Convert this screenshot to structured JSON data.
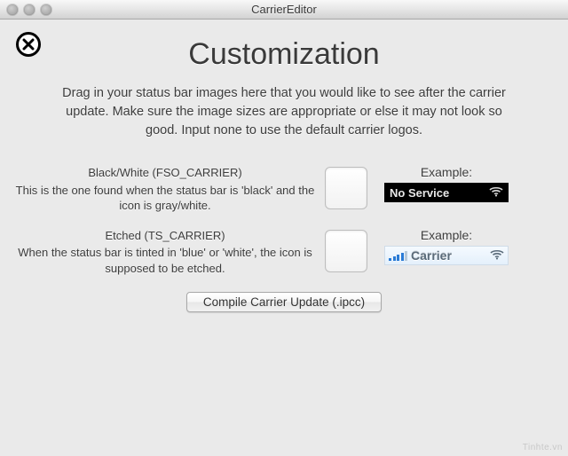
{
  "window": {
    "title": "CarrierEditor"
  },
  "page": {
    "heading": "Customization",
    "description": "Drag in your status bar images here that you would like to see after the carrier update. Make sure the image sizes are appropriate or else it may not look so good. Input none to use the default carrier logos."
  },
  "rows": [
    {
      "label": "Black/White (FSO_CARRIER)",
      "desc": "This is the one found when the status bar is 'black' and the icon is gray/white.",
      "example_label": "Example:",
      "example_text": "No Service"
    },
    {
      "label": "Etched (TS_CARRIER)",
      "desc": "When the status bar is tinted in 'blue' or 'white', the icon is supposed to be etched.",
      "example_label": "Example:",
      "example_text": "Carrier"
    }
  ],
  "button": {
    "compile": "Compile Carrier Update (.ipcc)"
  },
  "watermark": "Tinhte.vn"
}
